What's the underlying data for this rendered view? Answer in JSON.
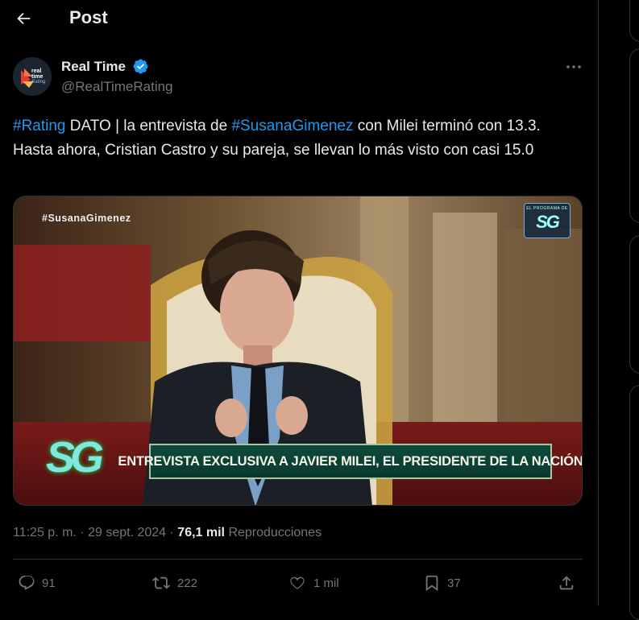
{
  "header": {
    "title": "Post"
  },
  "author": {
    "name": "Real Time",
    "handle": "@RealTimeRating",
    "avatar_lines": [
      "real",
      "time",
      "Rating"
    ]
  },
  "tweet": {
    "segments": [
      {
        "text": "#Rating",
        "hashtag": true
      },
      {
        "text": " DATO | la entrevista de ",
        "hashtag": false
      },
      {
        "text": "#SusanaGimenez",
        "hashtag": true
      },
      {
        "text": " con Milei terminó con 13.3. Hasta ahora, Cristian Castro y su pareja, se llevan lo más visto con casi 15.0",
        "hashtag": false
      }
    ]
  },
  "media": {
    "tag": "#SusanaGimenez",
    "badge_top": "EL PROGRAMA DE",
    "badge_main": "SG",
    "logo": "SG",
    "lower_third": "ENTREVISTA EXCLUSIVA A JAVIER MILEI, EL PRESIDENTE DE LA NACIÓN"
  },
  "meta": {
    "time": "11:25 p. m.",
    "date": "29 sept. 2024",
    "views_count": "76,1 mil",
    "views_label": "Reproducciones"
  },
  "actions": {
    "replies": "91",
    "reposts": "222",
    "likes": "1 mil",
    "bookmarks": "37"
  },
  "colors": {
    "background": "#000000",
    "text": "#e7e9ea",
    "muted": "#71767b",
    "accent": "#1d9bf0",
    "border": "#2f3336"
  },
  "icons": [
    "back-arrow-icon",
    "verified-badge-icon",
    "more-icon",
    "reply-icon",
    "repost-icon",
    "like-icon",
    "bookmark-icon",
    "share-icon"
  ]
}
